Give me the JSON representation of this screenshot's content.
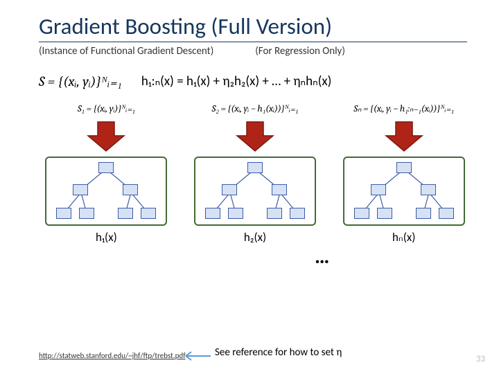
{
  "title": "Gradient Boosting (Full Version)",
  "sub1": "(Instance of Functional Gradient Descent)",
  "sub2": "(For Regression Only)",
  "S_def": "S = {(xᵢ, yᵢ)}ᴺᵢ₌₁",
  "main_formula": "h₁:ₙ(x) = h₁(x) + η₂h₂(x) + … + ηₙhₙ(x)",
  "eq": {
    "s1": "S₁ = {(xᵢ, yᵢ)}ᴺᵢ₌₁",
    "s2": "S₂ = {(xᵢ, yᵢ − h₁(xᵢ))}ᴺᵢ₌₁",
    "sn": "Sₙ = {(xᵢ, yᵢ − h₁:ₙ₋₁(xᵢ))}ᴺᵢ₌₁"
  },
  "hlabels": {
    "h1": "h₁(x)",
    "h2": "h₂(x)",
    "hn": "hₙ(x)"
  },
  "dots": "…",
  "footer_link": "http://statweb.stanford.edu/~jhf/ftp/trebst.pdf",
  "see_ref_pre": "See reference for how to set η",
  "page": "33",
  "colors": {
    "arrow_fill": "#b02418",
    "arrow_edge": "#7a180f"
  }
}
